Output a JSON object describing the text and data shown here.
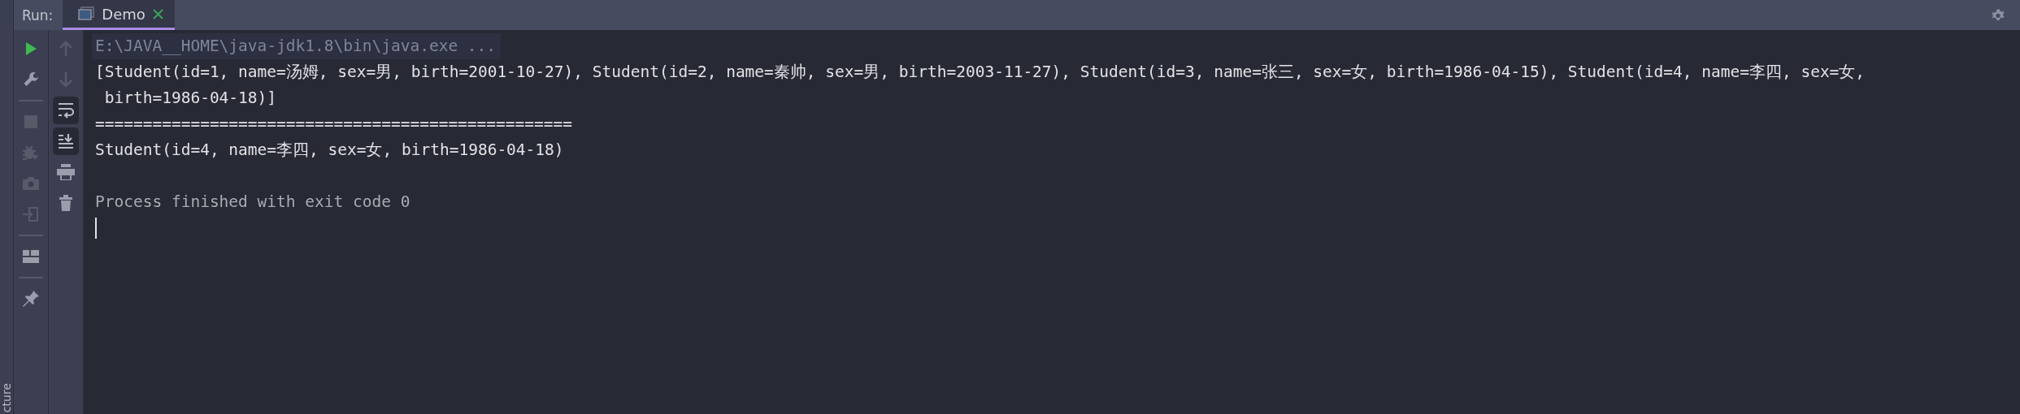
{
  "tool_window": {
    "title": "Run:",
    "tabs": [
      {
        "label": "Demo",
        "selected": true
      }
    ]
  },
  "side_label": "cture",
  "left_toolbar": [
    {
      "kind": "run",
      "disabled": false
    },
    {
      "kind": "wrench",
      "disabled": false
    },
    {
      "kind": "separator"
    },
    {
      "kind": "stop",
      "disabled": true
    },
    {
      "kind": "debug",
      "disabled": true
    },
    {
      "kind": "camera",
      "disabled": true
    },
    {
      "kind": "exit",
      "disabled": true
    },
    {
      "kind": "separator"
    },
    {
      "kind": "layout",
      "disabled": false
    },
    {
      "kind": "separator"
    },
    {
      "kind": "pin",
      "disabled": false
    }
  ],
  "right_toolbar": [
    {
      "kind": "up",
      "disabled": true,
      "selected": false
    },
    {
      "kind": "down",
      "disabled": true,
      "selected": false
    },
    {
      "kind": "wrap",
      "disabled": false,
      "selected": true
    },
    {
      "kind": "scroll-end",
      "disabled": false,
      "selected": true
    },
    {
      "kind": "print",
      "disabled": false,
      "selected": false
    },
    {
      "kind": "trash",
      "disabled": false,
      "selected": false
    }
  ],
  "console": {
    "lines": [
      {
        "kind": "command",
        "text": "E:\\JAVA__HOME\\java-jdk1.8\\bin\\java.exe ..."
      },
      {
        "kind": "output",
        "text": "[Student(id=1, name=汤姆, sex=男, birth=2001-10-27), Student(id=2, name=秦帅, sex=男, birth=2003-11-27), Student(id=3, name=张三, sex=女, birth=1986-04-15), Student(id=4, name=李四, sex=女,"
      },
      {
        "kind": "output",
        "text": " birth=1986-04-18)]"
      },
      {
        "kind": "output",
        "text": "=================================================="
      },
      {
        "kind": "output",
        "text": "Student(id=4, name=李四, sex=女, birth=1986-04-18)"
      },
      {
        "kind": "system",
        "text": "Process finished with exit code 0"
      }
    ],
    "caret": true
  }
}
